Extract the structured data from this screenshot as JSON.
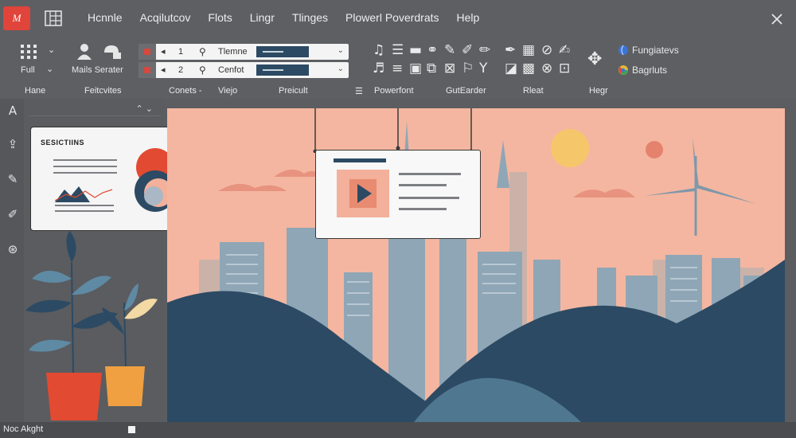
{
  "app": {
    "logo_text": "M"
  },
  "menu": [
    "Hcnnle",
    "Acqilutcov",
    "Flots",
    "Lingr",
    "Tlinges",
    "Plowerl Poverdrats",
    "Help"
  ],
  "ribbon": {
    "full_label": "Full",
    "mails_label": "Mails Serater",
    "combo1": {
      "bullet": "◂",
      "number": "1",
      "text": "Tlemne"
    },
    "combo2": {
      "bullet": "◂",
      "number": "2",
      "text": "Cenfot"
    },
    "right_items": [
      "Fungiatevs",
      "Bagrluts"
    ],
    "section_labels": [
      "Hane",
      "Feitcvites",
      "Conets -",
      "Viejo",
      "Preicult",
      "Powerfont",
      "GutEarder",
      "Rleat",
      "Hegr"
    ]
  },
  "panel": {
    "card_title": "SESICTIINS"
  },
  "statusbar": {
    "text": "Noc Akght"
  },
  "colors": {
    "accent": "#e0443a",
    "canvas_bg": "#f4b6a0",
    "navy": "#2c4a63",
    "orange": "#e24a32",
    "sun": "#f6c76a"
  },
  "icons": [
    "grid-icon",
    "person-icon",
    "shape-icon",
    "close-icon",
    "text-icon",
    "edit-icon",
    "note-icon",
    "brush-icon",
    "globe-icon",
    "play-icon",
    "move-icon"
  ]
}
